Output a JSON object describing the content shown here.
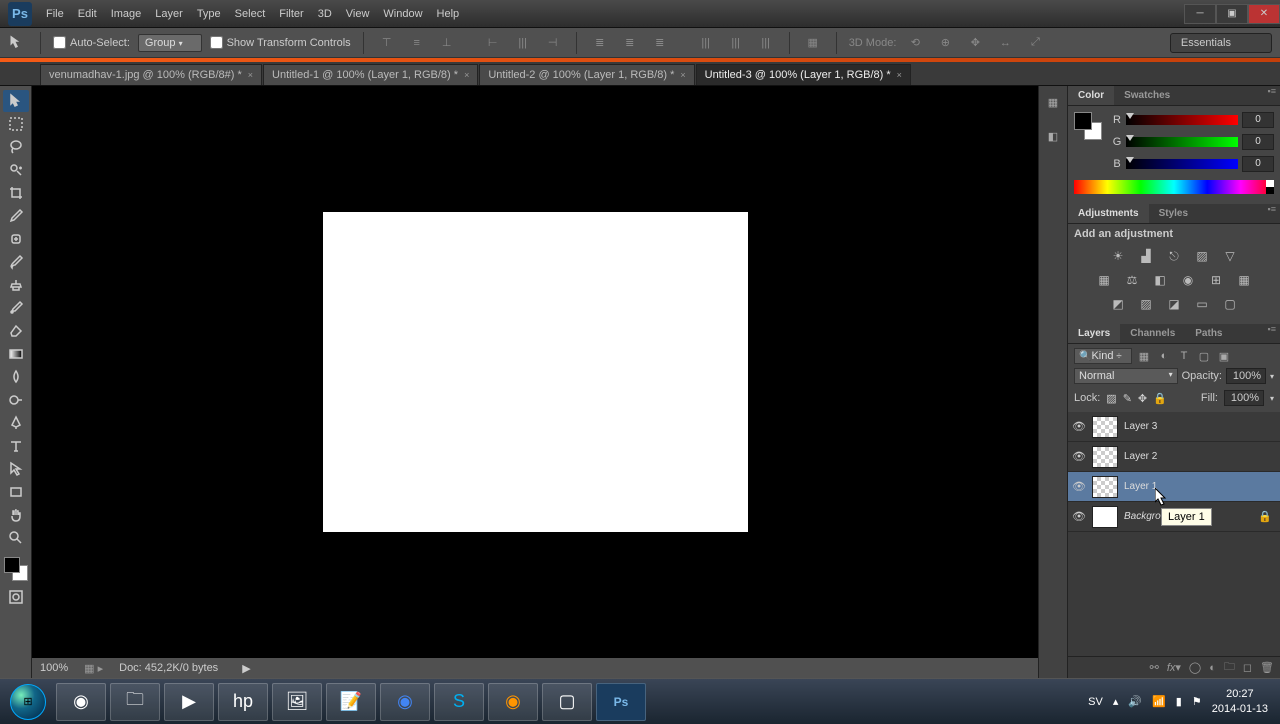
{
  "menu": {
    "file": "File",
    "edit": "Edit",
    "image": "Image",
    "layer": "Layer",
    "type": "Type",
    "select": "Select",
    "filter": "Filter",
    "threeD": "3D",
    "view": "View",
    "window": "Window",
    "help": "Help"
  },
  "options": {
    "autoSelect": "Auto-Select:",
    "group": "Group",
    "showTransform": "Show Transform Controls",
    "threeDMode": "3D Mode:"
  },
  "workspace": "Essentials",
  "tabs": [
    {
      "label": "venumadhav-1.jpg @ 100% (RGB/8#) *",
      "active": false
    },
    {
      "label": "Untitled-1 @ 100% (Layer 1, RGB/8) *",
      "active": false
    },
    {
      "label": "Untitled-2 @ 100% (Layer 1, RGB/8) *",
      "active": false
    },
    {
      "label": "Untitled-3 @ 100% (Layer 1, RGB/8) *",
      "active": true
    }
  ],
  "status": {
    "zoom": "100%",
    "doc": "Doc: 452,2K/0 bytes"
  },
  "colorPanel": {
    "tab1": "Color",
    "tab2": "Swatches",
    "r": "R",
    "g": "G",
    "b": "B",
    "rv": "0",
    "gv": "0",
    "bv": "0"
  },
  "adjPanel": {
    "tab1": "Adjustments",
    "tab2": "Styles",
    "label": "Add an adjustment"
  },
  "layersPanel": {
    "tab1": "Layers",
    "tab2": "Channels",
    "tab3": "Paths",
    "kind": "Kind",
    "blend": "Normal",
    "opacityLabel": "Opacity:",
    "opacity": "100%",
    "lockLabel": "Lock:",
    "fillLabel": "Fill:",
    "fill": "100%",
    "layers": [
      {
        "name": "Layer 3",
        "selected": false,
        "bg": false
      },
      {
        "name": "Layer 2",
        "selected": false,
        "bg": false
      },
      {
        "name": "Layer 1",
        "selected": true,
        "bg": false
      },
      {
        "name": "Background",
        "selected": false,
        "bg": true
      }
    ]
  },
  "tooltip": "Layer 1",
  "tray": {
    "lang": "SV",
    "time": "20:27",
    "date": "2014-01-13"
  }
}
